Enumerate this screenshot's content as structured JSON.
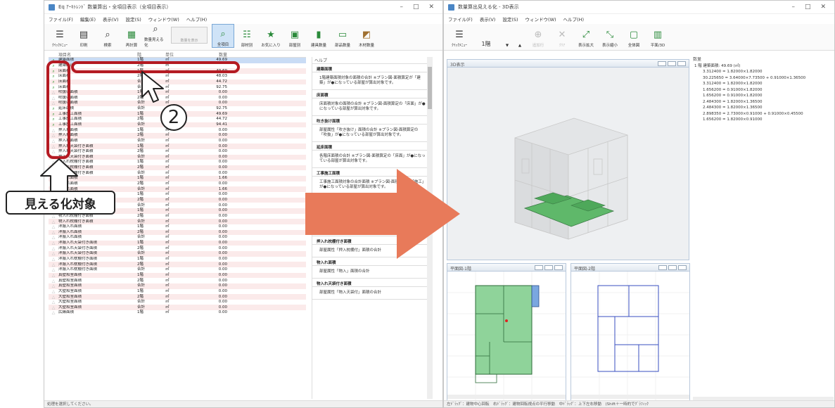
{
  "left_window": {
    "title": "Eq ｱｰｷﾄﾚﾝﾄﾞ 数量算出・全項目表示（全項目表示）",
    "menu": [
      "ファイル(F)",
      "編集(E)",
      "表示(V)",
      "設定(S)",
      "ウィンドウ(W)",
      "ヘルプ(H)"
    ],
    "toolbar": [
      "ｸｲｯｸﾒﾆｭｰ",
      "印刷",
      "検索",
      "再計算",
      "数量見える化",
      "全項目",
      "部材別",
      "お気に入り",
      "部屋別",
      "建具数量",
      "部品数量",
      "木材数量"
    ],
    "ghost_button": "数量を表示",
    "list_header": [
      "項目名",
      "階",
      "単位",
      "数量"
    ],
    "rows": [
      {
        "name": "建築面積",
        "floor": "1階",
        "unit": "㎡",
        "value": "49.69",
        "icon": "q"
      },
      {
        "name": "建築面積",
        "floor": "2階",
        "unit": "㎡",
        "value": "",
        "icon": "q"
      },
      {
        "name": "床面積",
        "floor": "1階",
        "unit": "㎡",
        "value": "49.69",
        "icon": "q"
      },
      {
        "name": "床面積",
        "floor": "2階",
        "unit": "㎡",
        "value": "48.03",
        "icon": "q"
      },
      {
        "name": "床面積",
        "floor": "合計",
        "unit": "㎡",
        "value": "44.72",
        "icon": "q"
      },
      {
        "name": "床面積",
        "floor": "合計",
        "unit": "㎡",
        "value": "92.75",
        "icon": "q"
      },
      {
        "name": "吹抜け面積",
        "floor": "1階",
        "unit": "㎡",
        "value": "0.00",
        "icon": "dim"
      },
      {
        "name": "吹抜け面積",
        "floor": "2階",
        "unit": "㎡",
        "value": "0.00",
        "icon": "dim"
      },
      {
        "name": "吹抜け面積",
        "floor": "合計",
        "unit": "㎡",
        "value": "0.00",
        "icon": "dim"
      },
      {
        "name": "延床面積",
        "floor": "合計",
        "unit": "㎡",
        "value": "92.75",
        "icon": "q"
      },
      {
        "name": "工事施工面積",
        "floor": "1階",
        "unit": "㎡",
        "value": "49.69",
        "icon": "q"
      },
      {
        "name": "工事施工面積",
        "floor": "2階",
        "unit": "㎡",
        "value": "44.72",
        "icon": "q"
      },
      {
        "name": "工事施工面積",
        "floor": "合計",
        "unit": "㎡",
        "value": "94.41",
        "icon": "q"
      },
      {
        "name": "押入れ面積",
        "floor": "1階",
        "unit": "㎡",
        "value": "0.00",
        "icon": "dim"
      },
      {
        "name": "押入れ面積",
        "floor": "2階",
        "unit": "㎡",
        "value": "0.00",
        "icon": "dim"
      },
      {
        "name": "押入れ面積",
        "floor": "合計",
        "unit": "㎡",
        "value": "0.00",
        "icon": "dim"
      },
      {
        "name": "押入れ天袋付き面積",
        "floor": "1階",
        "unit": "㎡",
        "value": "0.00",
        "icon": "dim"
      },
      {
        "name": "押入れ天袋付き面積",
        "floor": "2階",
        "unit": "㎡",
        "value": "0.00",
        "icon": "dim"
      },
      {
        "name": "押入れ天袋付き面積",
        "floor": "合計",
        "unit": "㎡",
        "value": "0.00",
        "icon": "dim"
      },
      {
        "name": "押入れ枕棚付き面積",
        "floor": "1階",
        "unit": "㎡",
        "value": "0.00",
        "icon": "dim"
      },
      {
        "name": "押入れ枕棚付き面積",
        "floor": "2階",
        "unit": "㎡",
        "value": "0.00",
        "icon": "dim"
      },
      {
        "name": "押入れ枕棚付き面積",
        "floor": "合計",
        "unit": "㎡",
        "value": "0.00",
        "icon": "dim"
      },
      {
        "name": "物入れ面積",
        "floor": "1階",
        "unit": "㎡",
        "value": "1.66",
        "icon": "dim"
      },
      {
        "name": "物入れ面積",
        "floor": "2階",
        "unit": "㎡",
        "value": "0.00",
        "icon": "dim"
      },
      {
        "name": "物入れ面積",
        "floor": "合計",
        "unit": "㎡",
        "value": "1.66",
        "icon": "dim"
      },
      {
        "name": "物入れ天袋付き面積",
        "floor": "1階",
        "unit": "㎡",
        "value": "0.00",
        "icon": "dim"
      },
      {
        "name": "物入れ天袋付き面積",
        "floor": "2階",
        "unit": "㎡",
        "value": "0.00",
        "icon": "dim"
      },
      {
        "name": "物入れ天袋付き面積",
        "floor": "合計",
        "unit": "㎡",
        "value": "0.00",
        "icon": "dim"
      },
      {
        "name": "物入れ枕棚付き面積",
        "floor": "1階",
        "unit": "㎡",
        "value": "0.00",
        "icon": "dim"
      },
      {
        "name": "物入れ枕棚付き面積",
        "floor": "2階",
        "unit": "㎡",
        "value": "0.00",
        "icon": "dim"
      },
      {
        "name": "物入れ枕棚付き面積",
        "floor": "合計",
        "unit": "㎡",
        "value": "0.00",
        "icon": "dim"
      },
      {
        "name": "洋服入れ面積",
        "floor": "1階",
        "unit": "㎡",
        "value": "0.00",
        "icon": "dim"
      },
      {
        "name": "洋服入れ面積",
        "floor": "2階",
        "unit": "㎡",
        "value": "0.00",
        "icon": "dim"
      },
      {
        "name": "洋服入れ面積",
        "floor": "合計",
        "unit": "㎡",
        "value": "0.00",
        "icon": "dim"
      },
      {
        "name": "洋服入れ天袋付き面積",
        "floor": "1階",
        "unit": "㎡",
        "value": "0.00",
        "icon": "dim"
      },
      {
        "name": "洋服入れ天袋付き面積",
        "floor": "2階",
        "unit": "㎡",
        "value": "0.00",
        "icon": "dim"
      },
      {
        "name": "洋服入れ天袋付き面積",
        "floor": "合計",
        "unit": "㎡",
        "value": "0.00",
        "icon": "dim"
      },
      {
        "name": "洋服入れ枕棚付き面積",
        "floor": "1階",
        "unit": "㎡",
        "value": "0.00",
        "icon": "dim"
      },
      {
        "name": "洋服入れ枕棚付き面積",
        "floor": "2階",
        "unit": "㎡",
        "value": "0.00",
        "icon": "dim"
      },
      {
        "name": "洋服入れ枕棚付き面積",
        "floor": "合計",
        "unit": "㎡",
        "value": "0.00",
        "icon": "dim"
      },
      {
        "name": "真壁和室面積",
        "floor": "1階",
        "unit": "㎡",
        "value": "0.00",
        "icon": "dim"
      },
      {
        "name": "真壁和室面積",
        "floor": "2階",
        "unit": "㎡",
        "value": "0.00",
        "icon": "dim"
      },
      {
        "name": "真壁和室面積",
        "floor": "合計",
        "unit": "㎡",
        "value": "0.00",
        "icon": "dim"
      },
      {
        "name": "大壁和室面積",
        "floor": "1階",
        "unit": "㎡",
        "value": "0.00",
        "icon": "dim"
      },
      {
        "name": "大壁和室面積",
        "floor": "2階",
        "unit": "㎡",
        "value": "0.00",
        "icon": "dim"
      },
      {
        "name": "大壁和室面積",
        "floor": "合計",
        "unit": "㎡",
        "value": "0.00",
        "icon": "dim"
      },
      {
        "name": "大壁和室面積",
        "floor": "合計",
        "unit": "㎡",
        "value": "0.00",
        "icon": "dim"
      },
      {
        "name": "広縁面積",
        "floor": "1階",
        "unit": "㎡",
        "value": "0.00",
        "icon": "dim"
      }
    ],
    "help": {
      "title": "ヘルプ",
      "sections": [
        {
          "h": "建築面積",
          "b": "1階建築面積対象の面積の合計 ※プラン図-面積算定が「建築」が●になっている部屋が算出対象です。"
        },
        {
          "h": "床面積",
          "b": "床面積対象の面積の合計 ※プラン図-面積算定の「床面」が●になっている部屋が算出対象です。"
        },
        {
          "h": "吹き抜け面積",
          "b": "部屋属性「吹き抜け」面積の合計 ※プラン図-面積算定の「吹抜」が●になっている部屋が算出対象です。"
        },
        {
          "h": "延床面積",
          "b": "各階床面積の合計 ※プラン図-面積算定の「床面」が●になっている部屋が算出対象です。"
        },
        {
          "h": "工事施工面積",
          "b": "工事施工面積対象の合計面積 ※プラン図-面積算定の「施工」が●になっている部屋が算出対象です。"
        },
        {
          "h": "押入れ面積",
          "b": "部屋属性「押入」面積の合計"
        },
        {
          "h": "押入れ天袋付き面積",
          "b": "部屋属性「押入天袋付」面積の合計"
        },
        {
          "h": "押入れ枕棚付き面積",
          "b": "部屋属性「押入枕棚付」面積の合計"
        },
        {
          "h": "物入れ面積",
          "b": "部屋属性「物入」面積の合計"
        },
        {
          "h": "物入れ天袋付き面積",
          "b": "部屋属性「物入天袋付」面積の合計"
        }
      ]
    },
    "status": "処理を選択してください。"
  },
  "right_window": {
    "title": "数量算出見える化 - 3D表示",
    "menu": [
      "ファイル(F)",
      "表示(V)",
      "設定(S)",
      "ウィンドウ(W)",
      "ヘルプ(H)"
    ],
    "toolbar": [
      "ｸｲｯｸﾒﾆｭｰ",
      "1階",
      "▼",
      "▲",
      "追加行",
      "ｸﾘｱ",
      "表示拡大",
      "表示縮小",
      "全体図",
      "平面/3D"
    ],
    "view3d_title": "3D表示",
    "plan1_title": "平面図-1階",
    "plan2_title": "平面図-2階",
    "qty_title": "数量",
    "qty_total": "1 階 建築面積: 49.69 (㎡)",
    "qty_lines": [
      "3.312400 = 1.82000×1.82000",
      "30.225650 = 3.64000×7.73500 + 0.91000×1.36500",
      "3.312400 = 1.82000×1.82000",
      "1.656200 = 0.91000×1.82000",
      "1.656200 = 0.91000×1.82000",
      "2.484300 = 1.82000×1.36500",
      "2.484300 = 1.82000×1.36500",
      "2.898350 = 2.73000×0.91000 + 0.91000×0.45500",
      "1.656200 = 1.82000×0.91000"
    ],
    "status": "左ﾄﾞﾗｯｸﾞ：建物中心回転　右ﾄﾞﾗｯｸﾞ：建物回転視点の平行移動　中ﾄﾞﾗｯｸﾞ：上下左右移動　(Shift＋一時的でｸﾞﾗﾌｨｯｸ"
  },
  "annotations": {
    "step_number": "2",
    "label": "見える化対象"
  },
  "colors": {
    "highlight_red": "#b41a22",
    "arrow_orange": "#e87a5a",
    "floor_green": "#5fb86a",
    "selection_blue": "#c9dcf5"
  }
}
